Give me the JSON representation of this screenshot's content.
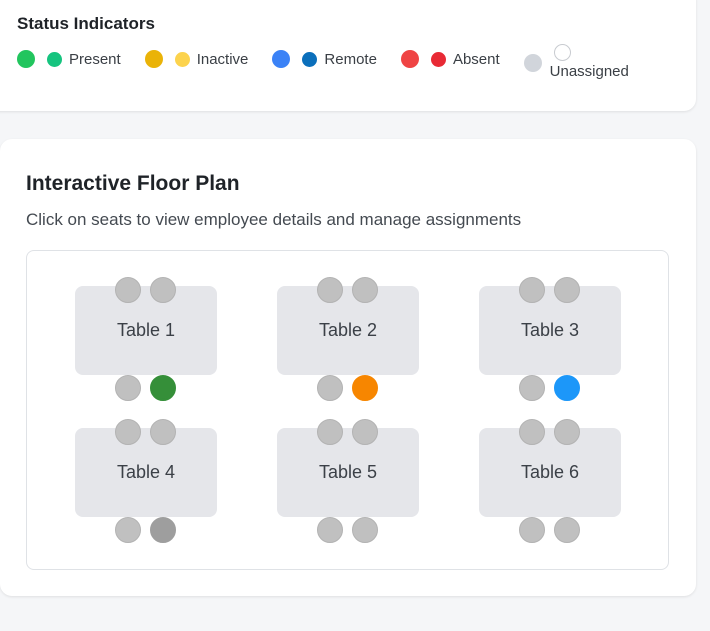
{
  "status": {
    "title": "Status Indicators",
    "items": [
      {
        "label": "Present",
        "big_color": "#22c55e",
        "small_color": "#16c47f"
      },
      {
        "label": "Inactive",
        "big_color": "#eab308",
        "small_color": "#fcd34d"
      },
      {
        "label": "Remote",
        "big_color": "#3b82f6",
        "small_color": "#0b6fbb"
      },
      {
        "label": "Absent",
        "big_color": "#ef4444",
        "small_color": "#e82a35"
      },
      {
        "label": "Unassigned",
        "big_color": "#d1d5db",
        "small_color": "#ffffff"
      }
    ]
  },
  "floor": {
    "title": "Interactive Floor Plan",
    "subtitle": "Click on seats to view employee details and manage assignments",
    "tables": [
      {
        "label": "Table 1",
        "seat_colors": [
          "#c0c0c0",
          "#c0c0c0",
          "#c0c0c0",
          "#388e3c"
        ]
      },
      {
        "label": "Table 2",
        "seat_colors": [
          "#c0c0c0",
          "#c0c0c0",
          "#c0c0c0",
          "#f28705"
        ]
      },
      {
        "label": "Table 3",
        "seat_colors": [
          "#c0c0c0",
          "#c0c0c0",
          "#c0c0c0",
          "#2196f3"
        ]
      },
      {
        "label": "Table 4",
        "seat_colors": [
          "#c0c0c0",
          "#c0c0c0",
          "#c0c0c0",
          "#9e9e9e"
        ]
      },
      {
        "label": "Table 5",
        "seat_colors": [
          "#c0c0c0",
          "#c0c0c0",
          "#c0c0c0",
          "#c0c0c0"
        ]
      },
      {
        "label": "Table 6",
        "seat_colors": [
          "#c0c0c0",
          "#c0c0c0",
          "#c0c0c0",
          "#c0c0c0"
        ]
      }
    ]
  }
}
